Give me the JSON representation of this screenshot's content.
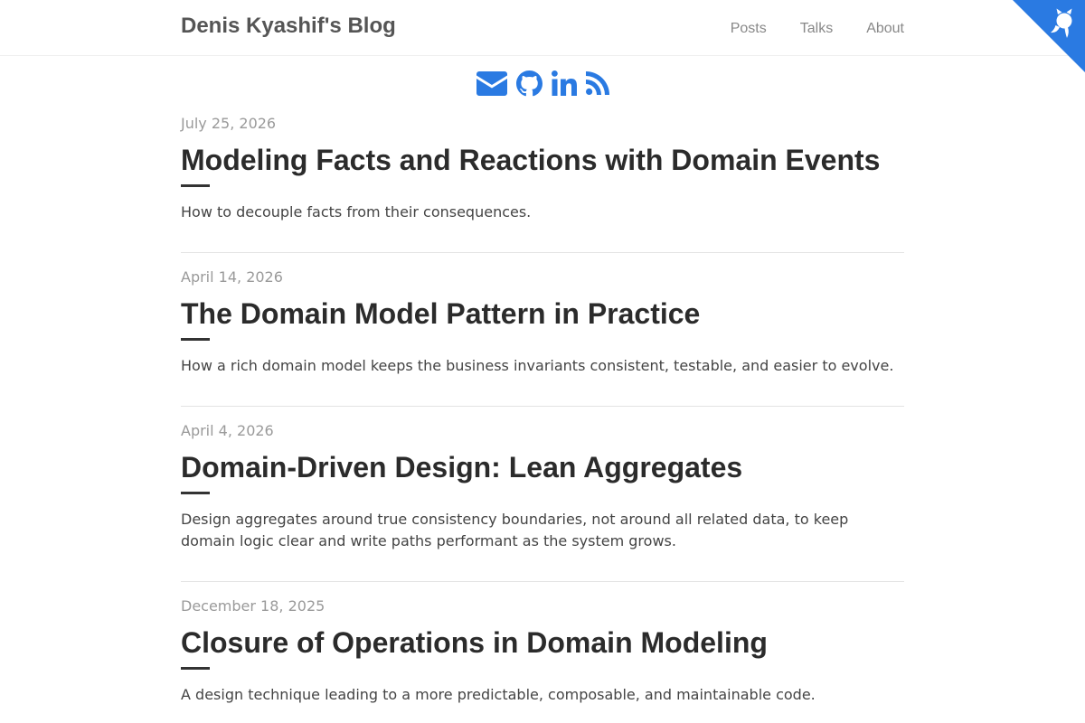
{
  "header": {
    "site_title": "Denis Kyashif's Blog",
    "nav": [
      {
        "label": "Posts"
      },
      {
        "label": "Talks"
      },
      {
        "label": "About"
      }
    ]
  },
  "corner_ribbon": {
    "icon": "github-octocat-icon",
    "color": "#2a7ae2"
  },
  "social": {
    "color": "#2a7ae2",
    "icons": [
      "envelope-icon",
      "github-icon",
      "linkedin-icon",
      "rss-icon"
    ]
  },
  "posts": [
    {
      "date": "July 25, 2026",
      "title": "Modeling Facts and Reactions with Domain Events",
      "summary": "How to decouple facts from their consequences."
    },
    {
      "date": "April 14, 2026",
      "title": "The Domain Model Pattern in Practice",
      "summary": "How a rich domain model keeps the business invariants consistent, testable, and easier to evolve."
    },
    {
      "date": "April 4, 2026",
      "title": "Domain-Driven Design: Lean Aggregates",
      "summary": "Design aggregates around true consistency boundaries, not around all related data, to keep domain logic clear and write paths performant as the system grows."
    },
    {
      "date": "December 18, 2025",
      "title": "Closure of Operations in Domain Modeling",
      "summary": "A design technique leading to a more predictable, composable, and maintainable code."
    }
  ]
}
